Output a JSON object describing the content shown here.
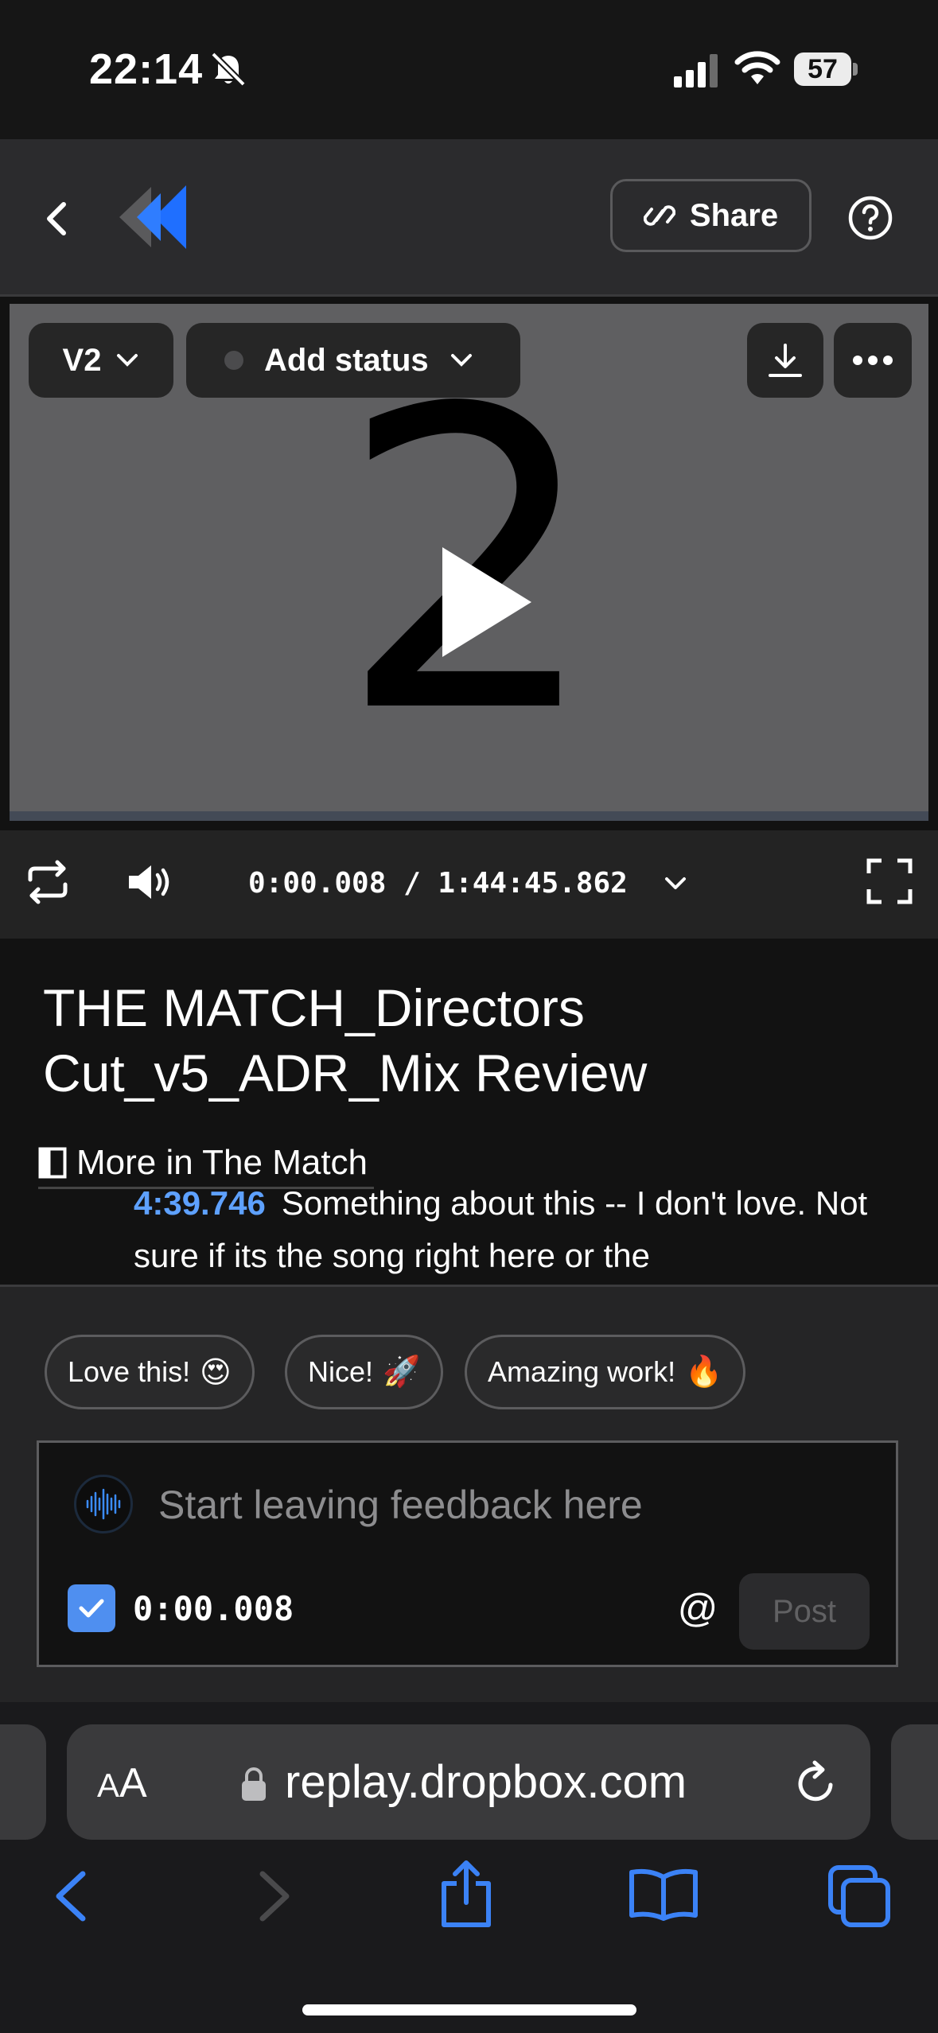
{
  "status_bar": {
    "time": "22:14",
    "battery": "57"
  },
  "header": {
    "share_label": "Share"
  },
  "video": {
    "frame_text": "2",
    "version_label": "V2",
    "status_label": "Add status",
    "progress_fraction": 0.0
  },
  "controls": {
    "timecode": "0:00.008 / 1:44:45.862"
  },
  "title": {
    "text": "THE MATCH_Directors Cut_v5_ADR_Mix Review",
    "more_link": "More in The Match"
  },
  "comment_preview": {
    "time": "4:39.746",
    "text": "Something about this -- I don't love. Not sure if its the song right here or the"
  },
  "quick_reactions": [
    {
      "label": "Love this!",
      "emoji": "😍"
    },
    {
      "label": "Nice!",
      "emoji": "🚀"
    },
    {
      "label": "Amazing work!",
      "emoji": "🔥"
    }
  ],
  "feedback": {
    "placeholder": "Start leaving feedback here",
    "timestamp": "0:00.008",
    "mention_symbol": "@",
    "post_label": "Post",
    "timestamp_checked": true
  },
  "browser": {
    "reader_big": "A",
    "reader_small": "A",
    "url": "replay.dropbox.com"
  },
  "colors": {
    "accent": "#5ea1ff",
    "checkbox": "#4f8ff0",
    "logo_blue": "#1f6fff"
  }
}
